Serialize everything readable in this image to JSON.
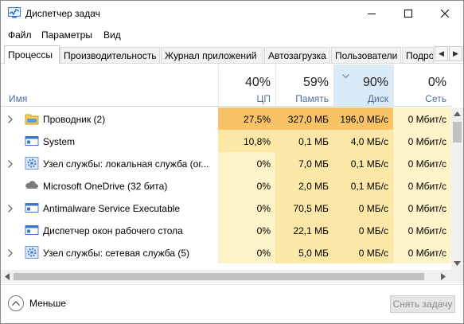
{
  "window": {
    "title": "Диспетчер задач"
  },
  "menu": [
    "Файл",
    "Параметры",
    "Вид"
  ],
  "tabs": [
    "Процессы",
    "Производительность",
    "Журнал приложений",
    "Автозагрузка",
    "Пользователи",
    "Подро"
  ],
  "active_tab": "Процессы",
  "columns": {
    "name": "Имя",
    "cpu": {
      "pct": "40%",
      "label": "ЦП"
    },
    "memory": {
      "pct": "59%",
      "label": "Память"
    },
    "disk": {
      "pct": "90%",
      "label": "Диск"
    },
    "network": {
      "pct": "0%",
      "label": "Сеть"
    }
  },
  "sorted_column": "disk",
  "rows": [
    {
      "name": "Проводник (2)",
      "icon": "explorer-folder-icon",
      "expandable": true,
      "cpu": "27,5%",
      "memory": "327,0 МБ",
      "disk": "196,0 МБ/с",
      "network": "0 Мбит/с"
    },
    {
      "name": "System",
      "icon": "system-window-icon",
      "expandable": false,
      "cpu": "10,8%",
      "memory": "0,1 МБ",
      "disk": "4,0 МБ/с",
      "network": "0 Мбит/с"
    },
    {
      "name": "Узел службы: локальная служба (ог...",
      "icon": "service-gear-icon",
      "expandable": true,
      "cpu": "0%",
      "memory": "7,0 МБ",
      "disk": "0,1 МБ/с",
      "network": "0 Мбит/с"
    },
    {
      "name": "Microsoft OneDrive (32 бита)",
      "icon": "onedrive-cloud-icon",
      "expandable": false,
      "cpu": "0%",
      "memory": "2,0 МБ",
      "disk": "0,1 МБ/с",
      "network": "0 Мбит/с"
    },
    {
      "name": "Antimalware Service Executable",
      "icon": "system-window-icon",
      "expandable": true,
      "cpu": "0%",
      "memory": "70,5 МБ",
      "disk": "0 МБ/с",
      "network": "0 Мбит/с"
    },
    {
      "name": "Диспетчер окон рабочего стола",
      "icon": "system-window-icon",
      "expandable": false,
      "cpu": "0%",
      "memory": "22,1 МБ",
      "disk": "0 МБ/с",
      "network": "0 Мбит/с"
    },
    {
      "name": "Узел службы: сетевая служба (5)",
      "icon": "service-gear-icon",
      "expandable": true,
      "cpu": "0%",
      "memory": "5,0 МБ",
      "disk": "0 МБ/с",
      "network": "0 Мбит/с"
    }
  ],
  "footer": {
    "less_label": "Меньше",
    "end_task_label": "Снять задачу"
  },
  "colors": {
    "heat_high": "#f8c366",
    "heat_medium": "#fbe7a6",
    "heat_low": "#fdf3c8",
    "header_label": "#4d6e9c",
    "sorted_header": "#dbeaf7",
    "accent_blue": "#1e6fc0"
  }
}
